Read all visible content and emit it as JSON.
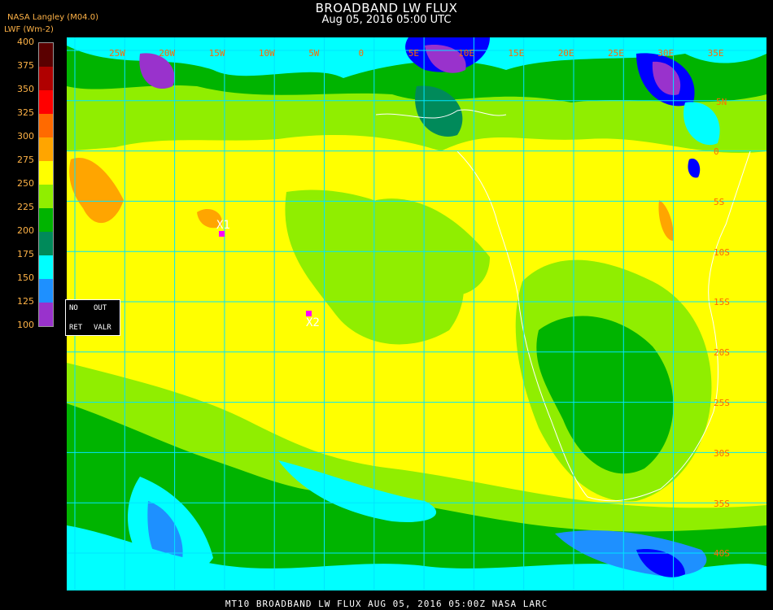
{
  "header": {
    "title": "BROADBAND LW FLUX",
    "subtitle": "Aug 05, 2016 05:00 UTC",
    "provider": "NASA Langley (M04.0)",
    "units": "LWF (Wm-2)"
  },
  "colorbar": {
    "labels": [
      "400",
      "375",
      "350",
      "325",
      "300",
      "275",
      "250",
      "225",
      "200",
      "175",
      "150",
      "125",
      "100"
    ],
    "colors": [
      "#5a0000",
      "#b00000",
      "#ff0000",
      "#ff6a00",
      "#ffa500",
      "#ffff00",
      "#90ee00",
      "#00b400",
      "#008a5a",
      "#00ffff",
      "#1e90ff",
      "#0000ff",
      "#9932cc"
    ]
  },
  "legend_box": {
    "no": "NO",
    "out": "OUT",
    "ret": "RET",
    "valr": "VALR"
  },
  "grid": {
    "color": "#00e5ff",
    "lon_labels": [
      "25W",
      "20W",
      "15W",
      "10W",
      "5W",
      "0",
      "5E",
      "10E",
      "15E",
      "20E",
      "25E",
      "30E",
      "35E"
    ],
    "lat_labels": [
      "0",
      "5S",
      "10S",
      "15S",
      "20S",
      "25S",
      "30S",
      "35S",
      "40S"
    ],
    "top_lat_label": "5N",
    "label_color": "#ff6a00"
  },
  "markers": [
    {
      "label": "X1"
    },
    {
      "label": "X2"
    }
  ],
  "footer": {
    "text": "MT10  BROADBAND LW FLUX   AUG 05, 2016 05:00Z   NASA LARC"
  }
}
